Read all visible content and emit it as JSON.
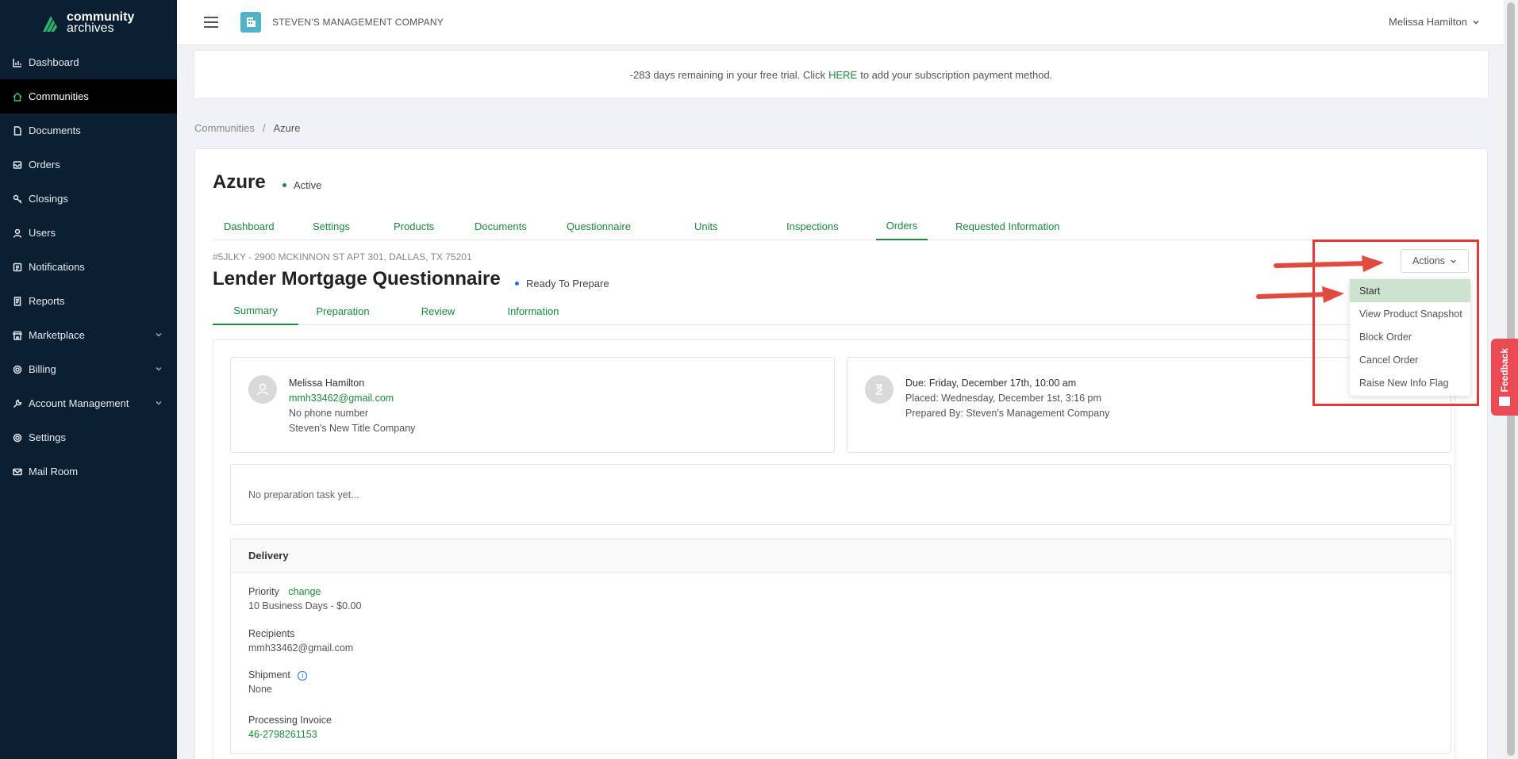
{
  "app": {
    "logo_line1": "community",
    "logo_line2": "archives",
    "company_name": "STEVEN'S MANAGEMENT COMPANY",
    "user_name": "Melissa Hamilton"
  },
  "sidebar": {
    "items": [
      {
        "label": "Dashboard",
        "icon": "chart-icon"
      },
      {
        "label": "Communities",
        "icon": "home-icon",
        "active": true
      },
      {
        "label": "Documents",
        "icon": "file-icon"
      },
      {
        "label": "Orders",
        "icon": "inbox-icon"
      },
      {
        "label": "Closings",
        "icon": "key-icon"
      },
      {
        "label": "Users",
        "icon": "user-icon"
      },
      {
        "label": "Notifications",
        "icon": "notification-icon"
      },
      {
        "label": "Reports",
        "icon": "report-icon"
      },
      {
        "label": "Marketplace",
        "icon": "store-icon",
        "expandable": true
      },
      {
        "label": "Billing",
        "icon": "gear-icon",
        "expandable": true
      },
      {
        "label": "Account Management",
        "icon": "wrench-icon",
        "expandable": true
      },
      {
        "label": "Settings",
        "icon": "gear-icon"
      },
      {
        "label": "Mail Room",
        "icon": "mail-icon"
      }
    ]
  },
  "banner": {
    "text_before": "-283 days remaining in your free trial. Click",
    "link": "HERE",
    "text_after": "to add your subscription payment method."
  },
  "breadcrumb": {
    "root": "Communities",
    "sep": "/",
    "current": "Azure"
  },
  "community": {
    "name": "Azure",
    "status": "Active",
    "status_color": "#1a8b3a"
  },
  "tabs": [
    {
      "label": "Dashboard"
    },
    {
      "label": "Settings"
    },
    {
      "label": "Products"
    },
    {
      "label": "Documents"
    },
    {
      "label": "Questionnaire"
    },
    {
      "label": "Units"
    },
    {
      "label": "Inspections"
    },
    {
      "label": "Orders",
      "active": true
    },
    {
      "label": "Requested Information"
    }
  ],
  "order": {
    "address": "#5JLKY - 2900 MCKINNON ST APT 301, DALLAS, TX 75201",
    "title": "Lender Mortgage Questionnaire",
    "status": "Ready To Prepare",
    "status_color": "#1a73e8"
  },
  "subtabs": [
    {
      "label": "Summary",
      "active": true
    },
    {
      "label": "Preparation"
    },
    {
      "label": "Review"
    },
    {
      "label": "Information"
    }
  ],
  "requester": {
    "name": "Melissa Hamilton",
    "email": "mmh33462@gmail.com",
    "phone": "No phone number",
    "company": "Steven's New Title Company"
  },
  "due": {
    "due": "Due: Friday, December 17th, 10:00 am",
    "placed": "Placed: Wednesday, December 1st, 3:16 pm",
    "prepared_by": "Prepared By: Steven's Management Company"
  },
  "preparation": {
    "empty_text": "No preparation task yet..."
  },
  "delivery": {
    "title": "Delivery",
    "priority_label": "Priority",
    "priority_change": "change",
    "priority_value": "10 Business Days - $0.00",
    "recipients_label": "Recipients",
    "recipients_value": "mmh33462@gmail.com",
    "shipment_label": "Shipment",
    "shipment_info_glyph": "i",
    "shipment_value": "None",
    "invoice_label": "Processing Invoice",
    "invoice_value": "46-2798261153"
  },
  "actions": {
    "label": "Actions",
    "items": [
      {
        "label": "Start",
        "hover": true
      },
      {
        "label": "View Product Snapshot"
      },
      {
        "label": "Block Order"
      },
      {
        "label": "Cancel Order"
      },
      {
        "label": "Raise New Info Flag"
      }
    ]
  },
  "feedback": {
    "label": "Feedback"
  },
  "colors": {
    "sidebar_bg": "#0b1f33",
    "accent": "#1a8b3a",
    "annotation_red": "#e53935",
    "feedback_bg": "#ea4a55"
  }
}
